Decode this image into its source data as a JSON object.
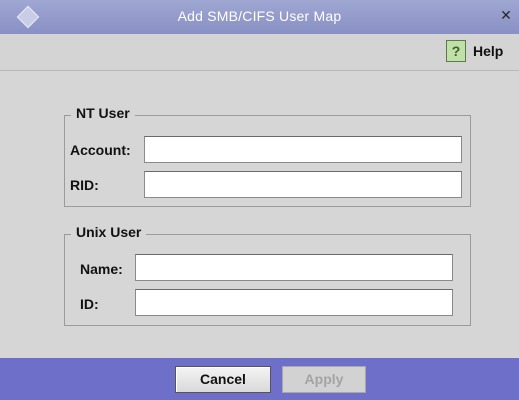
{
  "window": {
    "title": "Add SMB/CIFS User Map",
    "close_icon": "close-icon",
    "app_icon": "diamond-icon"
  },
  "toolbar": {
    "help_label": "Help",
    "help_icon": "help-question-icon"
  },
  "nt_user": {
    "group_title": "NT User",
    "account_label": "Account:",
    "account_value": "",
    "rid_label": "RID:",
    "rid_value": ""
  },
  "unix_user": {
    "group_title": "Unix User",
    "name_label": "Name:",
    "name_value": "",
    "id_label": "ID:",
    "id_value": ""
  },
  "footer": {
    "cancel_label": "Cancel",
    "apply_label": "Apply",
    "apply_enabled": false,
    "accent_color": "#6e6fc8"
  }
}
